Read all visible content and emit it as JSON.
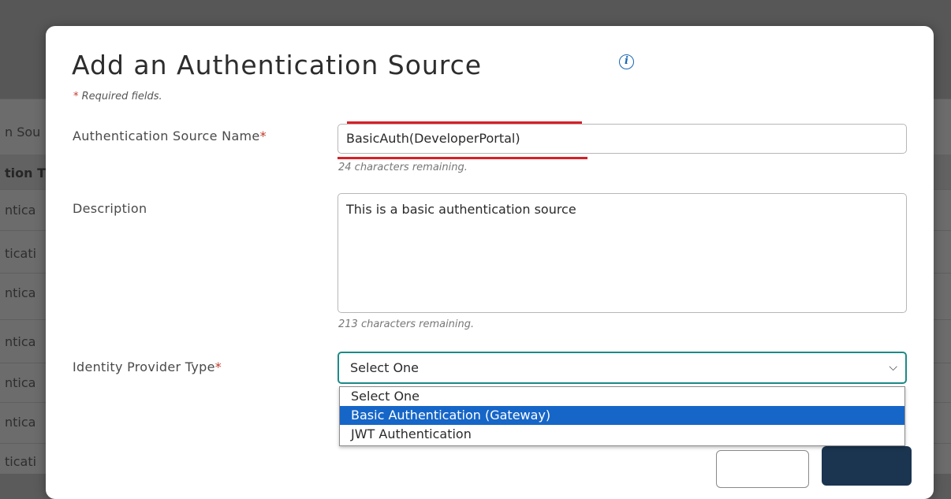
{
  "background": {
    "rows": [
      {
        "text": "n Sou",
        "bold": false
      },
      {
        "text": "tion T",
        "bold": true
      },
      {
        "text": "ntica",
        "bold": false
      },
      {
        "text": "ticati",
        "bold": false
      },
      {
        "text": "ntica",
        "bold": false
      },
      {
        "text": "ntica",
        "bold": false
      },
      {
        "text": "ntica",
        "bold": false
      },
      {
        "text": "ntica",
        "bold": false
      },
      {
        "text": "ticati",
        "bold": false
      }
    ]
  },
  "modal": {
    "title": "Add an Authentication Source",
    "info_icon": "info-icon",
    "required_star": "*",
    "required_note": "Required fields.",
    "name_label": "Authentication Source Name",
    "name_value": "BasicAuth(DeveloperPortal)",
    "name_hint": "24 characters remaining.",
    "description_label": "Description",
    "description_value": "This is a basic authentication source",
    "description_hint": "213 characters remaining.",
    "idp_label": "Identity Provider Type",
    "idp_selected": "Select One",
    "idp_options": [
      "Select One",
      "Basic Authentication (Gateway)",
      "JWT Authentication"
    ],
    "idp_highlighted_index": 1
  },
  "colors": {
    "required": "#c0392b",
    "select_focus": "#1d8a86",
    "highlight": "#1666c8",
    "primary_button": "#1b3550",
    "annotation_red": "#d81f26"
  }
}
